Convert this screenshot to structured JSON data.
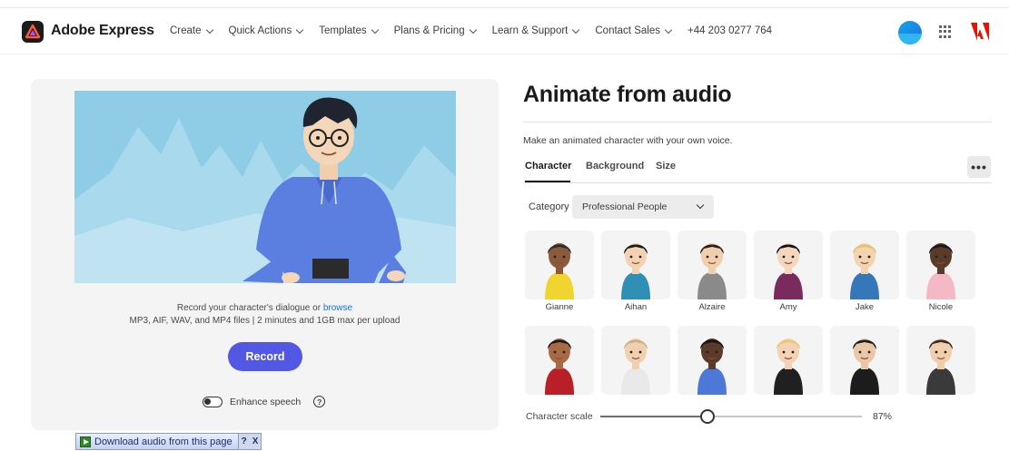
{
  "header": {
    "brand": "Adobe Express",
    "nav": [
      {
        "label": "Create"
      },
      {
        "label": "Quick Actions"
      },
      {
        "label": "Templates"
      },
      {
        "label": "Plans & Pricing"
      },
      {
        "label": "Learn & Support"
      },
      {
        "label": "Contact Sales"
      }
    ],
    "phone": "+44 203 0277 764"
  },
  "preview": {
    "upload_text": "Record your character's dialogue or",
    "browse_label": "browse",
    "formats_text": "MP3, AIF, WAV, and MP4 files | 2 minutes and 1GB max per upload",
    "record_label": "Record",
    "enhance_label": "Enhance speech",
    "help_glyph": "?"
  },
  "download_bar": {
    "label": "Download audio from this page",
    "help": "?",
    "close": "X"
  },
  "panel": {
    "title": "Animate from audio",
    "subtitle": "Make an animated character with your own voice.",
    "tabs": [
      {
        "label": "Character"
      },
      {
        "label": "Background"
      },
      {
        "label": "Size"
      }
    ],
    "more_glyph": "•••",
    "category_label": "Category",
    "category_value": "Professional People",
    "characters": [
      {
        "name": "Gianne"
      },
      {
        "name": "Aihan"
      },
      {
        "name": "Alzaire"
      },
      {
        "name": "Amy"
      },
      {
        "name": "Jake"
      },
      {
        "name": "Nicole"
      },
      {
        "name": ""
      },
      {
        "name": ""
      },
      {
        "name": ""
      },
      {
        "name": ""
      },
      {
        "name": ""
      },
      {
        "name": ""
      }
    ],
    "scale_label": "Character scale",
    "scale_value_text": "87%",
    "scale_fraction": 0.41
  },
  "colors": {
    "accent": "#5258e4",
    "link": "#1473e6",
    "sky": "#8fcde6"
  }
}
